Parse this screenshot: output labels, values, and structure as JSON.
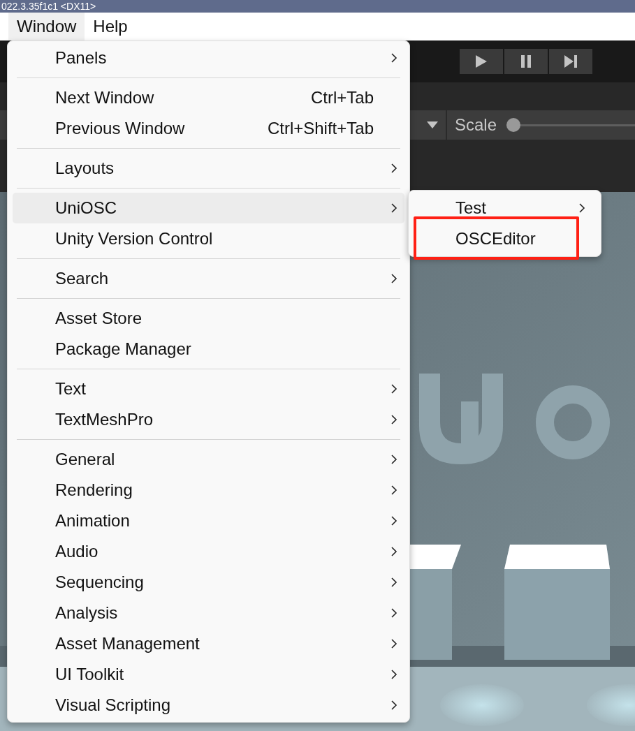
{
  "title_bar": {
    "text": "022.3.35f1c1 <DX11>"
  },
  "menu_bar": [
    {
      "label": "Window",
      "selected": true
    },
    {
      "label": "Help",
      "selected": false
    }
  ],
  "scene_toolbar": {
    "scale_label": "Scale",
    "scale_slider": {
      "level": 0
    }
  },
  "window_menu": {
    "items": [
      {
        "kind": "item",
        "label": "Panels",
        "has_submenu": true,
        "selected": false
      },
      {
        "kind": "separator"
      },
      {
        "kind": "item",
        "label": "Next Window",
        "shortcut": "Ctrl+Tab",
        "has_submenu": false,
        "selected": false
      },
      {
        "kind": "item",
        "label": "Previous Window",
        "shortcut": "Ctrl+Shift+Tab",
        "has_submenu": false,
        "selected": false
      },
      {
        "kind": "separator"
      },
      {
        "kind": "item",
        "label": "Layouts",
        "has_submenu": true,
        "selected": false
      },
      {
        "kind": "separator"
      },
      {
        "kind": "item",
        "label": "UniOSC",
        "has_submenu": true,
        "selected": true
      },
      {
        "kind": "item",
        "label": "Unity Version Control",
        "has_submenu": false,
        "selected": false
      },
      {
        "kind": "separator"
      },
      {
        "kind": "item",
        "label": "Search",
        "has_submenu": true,
        "selected": false
      },
      {
        "kind": "separator"
      },
      {
        "kind": "item",
        "label": "Asset Store",
        "has_submenu": false,
        "selected": false
      },
      {
        "kind": "item",
        "label": "Package Manager",
        "has_submenu": false,
        "selected": false
      },
      {
        "kind": "separator"
      },
      {
        "kind": "item",
        "label": "Text",
        "has_submenu": true,
        "selected": false
      },
      {
        "kind": "item",
        "label": "TextMeshPro",
        "has_submenu": true,
        "selected": false
      },
      {
        "kind": "separator"
      },
      {
        "kind": "item",
        "label": "General",
        "has_submenu": true,
        "selected": false
      },
      {
        "kind": "item",
        "label": "Rendering",
        "has_submenu": true,
        "selected": false
      },
      {
        "kind": "item",
        "label": "Animation",
        "has_submenu": true,
        "selected": false
      },
      {
        "kind": "item",
        "label": "Audio",
        "has_submenu": true,
        "selected": false
      },
      {
        "kind": "item",
        "label": "Sequencing",
        "has_submenu": true,
        "selected": false
      },
      {
        "kind": "item",
        "label": "Analysis",
        "has_submenu": true,
        "selected": false
      },
      {
        "kind": "item",
        "label": "Asset Management",
        "has_submenu": true,
        "selected": false
      },
      {
        "kind": "item",
        "label": "UI Toolkit",
        "has_submenu": true,
        "selected": false
      },
      {
        "kind": "item",
        "label": "Visual Scripting",
        "has_submenu": true,
        "selected": false
      }
    ]
  },
  "submenu": {
    "items": [
      {
        "label": "Test",
        "has_submenu": true,
        "outlined": false
      },
      {
        "label": "OSCEditor",
        "has_submenu": false,
        "outlined": true
      }
    ]
  }
}
